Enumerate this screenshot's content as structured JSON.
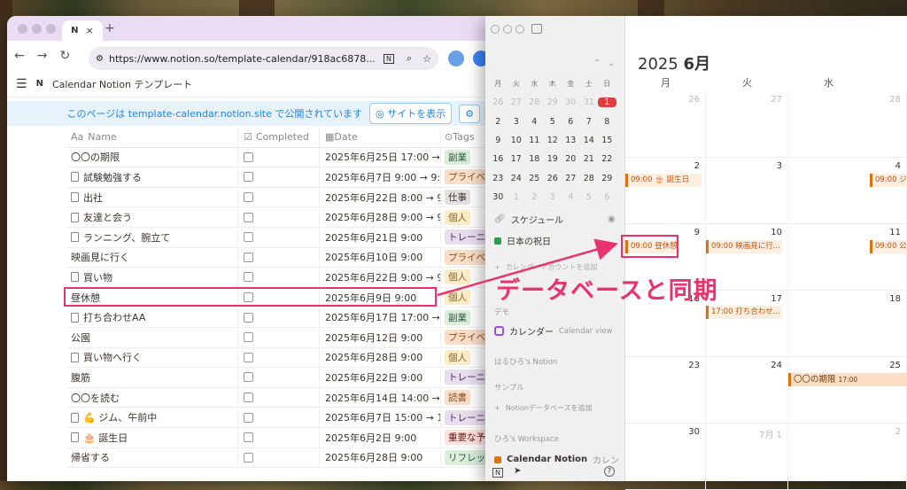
{
  "browser": {
    "tab_icon": "notion-icon",
    "url": "https://www.notion.so/template-calendar/918ac6878...",
    "page_title": "Calendar Notion テンプレート",
    "banner_text": "このページは template-calendar.notion.site で公開されています",
    "banner_button": "サイトを表示"
  },
  "table": {
    "headers": {
      "name": "Name",
      "completed": "Completed",
      "date": "Date",
      "tags": "Tags",
      "name_prefix": "Aa"
    },
    "rows": [
      {
        "name": "〇〇の期限",
        "doc": false,
        "date": "2025年6月25日 17:00 → 202",
        "tag": "副業",
        "tagbg": "#dbeddb",
        "tagfg": "#2b593f"
      },
      {
        "name": "試験勉強する",
        "doc": true,
        "date": "2025年6月7日 9:00 → 9:00",
        "tag": "プライベー",
        "tagbg": "#fadec9",
        "tagfg": "#854c1d"
      },
      {
        "name": "出社",
        "doc": true,
        "date": "2025年6月22日 8:00 → 9:00",
        "tag": "仕事",
        "tagbg": "#e3e2e0",
        "tagfg": "#32302c"
      },
      {
        "name": "友達と会う",
        "doc": true,
        "date": "2025年6月28日 9:00 → 9:00",
        "tag": "個人",
        "tagbg": "#fdecc8",
        "tagfg": "#89632a"
      },
      {
        "name": "ランニング、腕立て",
        "doc": true,
        "date": "2025年6月21日 9:00",
        "tag": "トレーニン",
        "tagbg": "#e8deee",
        "tagfg": "#492f64"
      },
      {
        "name": "映画見に行く",
        "doc": false,
        "date": "2025年6月10日 9:00",
        "tag": "プライベー",
        "tagbg": "#fadec9",
        "tagfg": "#854c1d"
      },
      {
        "name": "買い物",
        "doc": true,
        "date": "2025年6月22日 9:00 → 9:00",
        "tag": "個人",
        "tagbg": "#fdecc8",
        "tagfg": "#89632a"
      },
      {
        "name": "昼休憩",
        "doc": false,
        "date": "2025年6月9日 9:00",
        "tag": "個人",
        "tagbg": "#fdecc8",
        "tagfg": "#89632a"
      },
      {
        "name": "打ち合わせAA",
        "doc": true,
        "date": "2025年6月17日 17:00 → 18:0",
        "tag": "副業",
        "tagbg": "#dbeddb",
        "tagfg": "#2b593f"
      },
      {
        "name": "公園",
        "doc": false,
        "date": "2025年6月12日 9:00",
        "tag": "プライベー",
        "tagbg": "#fadec9",
        "tagfg": "#854c1d"
      },
      {
        "name": "買い物へ行く",
        "doc": true,
        "date": "2025年6月28日 9:00",
        "tag": "個人",
        "tagbg": "#fdecc8",
        "tagfg": "#89632a"
      },
      {
        "name": "腹筋",
        "doc": false,
        "date": "2025年6月22日 9:00",
        "tag": "トレーニン",
        "tagbg": "#e8deee",
        "tagfg": "#492f64"
      },
      {
        "name": "〇〇を読む",
        "doc": false,
        "date": "2025年6月14日 14:00 → 202",
        "tag": "読書",
        "tagbg": "#fadec9",
        "tagfg": "#854c1d"
      },
      {
        "name": "💪 ジム、午前中",
        "doc": true,
        "date": "2025年6月7日 15:00 → 18:00",
        "tag": "トレーニン",
        "tagbg": "#e8deee",
        "tagfg": "#492f64"
      },
      {
        "name": "🎂 誕生日",
        "doc": true,
        "date": "2025年6月2日 9:00",
        "tag": "重要な予定",
        "tagbg": "#ffe2dd",
        "tagfg": "#5d1715"
      },
      {
        "name": "帰省する",
        "doc": false,
        "date": "2025年6月28日 9:00",
        "tag": "リフレッシ",
        "tagbg": "#dbeddb",
        "tagfg": "#2b593f"
      }
    ]
  },
  "calendar": {
    "weekdays_mini": [
      "月",
      "火",
      "水",
      "木",
      "金",
      "土",
      "日"
    ],
    "mini_weeks": [
      [
        "26",
        "27",
        "28",
        "29",
        "30",
        "31",
        "1"
      ],
      [
        "2",
        "3",
        "4",
        "5",
        "6",
        "7",
        "8"
      ],
      [
        "9",
        "10",
        "11",
        "12",
        "13",
        "14",
        "15"
      ],
      [
        "16",
        "17",
        "18",
        "19",
        "20",
        "21",
        "22"
      ],
      [
        "23",
        "24",
        "25",
        "26",
        "27",
        "28",
        "29"
      ],
      [
        "30",
        "1",
        "2",
        "3",
        "4",
        "5",
        "6"
      ]
    ],
    "sidebar": {
      "schedule": "スケジュール",
      "holiday": "日本の祝日",
      "add_account": "カレンダーアカウントを追加",
      "section_demo": "デモ",
      "demo_item": "カレンダー",
      "demo_item_sub": "Calendar view",
      "section_notion": "はるひろ's Notion",
      "section_sample": "サンプル",
      "add_db": "Notionデータベースを追加",
      "section_workspace": "ひろ's Workspace",
      "workspace_item": "Calendar Notion",
      "workspace_item_sub": "カレン"
    },
    "month_title_year": "2025",
    "month_title_month": "6月",
    "weekdays": [
      "月",
      "火",
      "水"
    ],
    "weeks": [
      [
        "26",
        "27",
        "28"
      ],
      [
        "2",
        "3",
        "4"
      ],
      [
        "9",
        "10",
        "11"
      ],
      [
        "16",
        "17",
        "18"
      ],
      [
        "23",
        "24",
        "25"
      ],
      [
        "30",
        "7月 1",
        "2"
      ]
    ],
    "events": {
      "e1": "09:00 🎂 誕生日",
      "e1b": "09:00 ジム",
      "e2": "09:00 昼休憩",
      "e3": "09:00 映画見に行...",
      "e4": "09:00 公園",
      "e5": "17:00 打ち合わせ...",
      "e6": "〇〇の期限",
      "e6_time": "17:00"
    }
  },
  "annotation": {
    "text": "データベースと同期",
    "color": "#e8336f"
  }
}
